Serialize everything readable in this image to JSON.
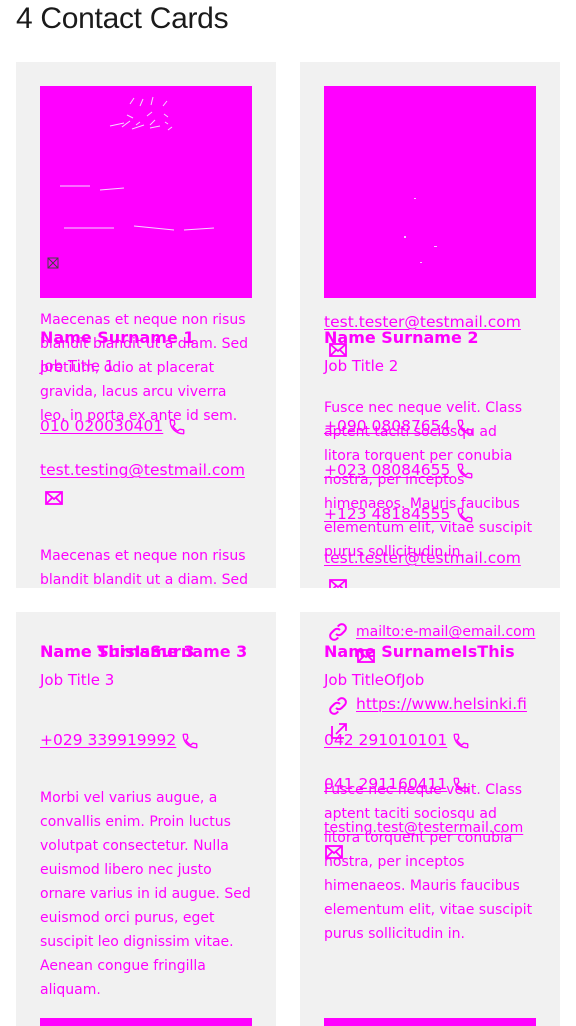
{
  "page": {
    "title": "4 Contact Cards"
  },
  "colors": {
    "accent": "#ff00ff",
    "card_bg": "#f1f1f1",
    "title_text": "#1a1a1a"
  },
  "cards": [
    {
      "name": "Name Surname 1",
      "job_title": "Job Title 1",
      "phones": [
        "010 020030401"
      ],
      "email": "test.testing@testmail.com",
      "about_top": "Maecenas et neque non risus blandit blandit ut a diam. Sed pretium, odio at placerat gravida, lacus arcu viverra leo, in porta ex ante id sem.",
      "about": "Maecenas et neque non risus blandit blandit ut a diam. Sed pretium, odio at placerat gravida, lacus arcu viverra leo, in porta ex ante id sem."
    },
    {
      "name": "Name Surname 2",
      "job_title": "Job Title 2",
      "email_top": "test.tester@testmail.com",
      "phones": [
        "+090 08087654",
        "+023 08084655",
        "+123 48184555"
      ],
      "email": "test.tester@testmail.com",
      "about": "Fusce nec neque velit. Class aptent taciti sociosqu ad litora torquent per conubia nostra, per inceptos himenaeos. Mauris faucibus elementum elit, vitae suscipit purus sollicitudin in."
    },
    {
      "name": "Name Surname 3",
      "name_overlap": "Name ThisIsSurname 3",
      "job_title": "Job Title 3",
      "phones": [
        "+029 339919992"
      ],
      "about": "Morbi vel varius augue, a convallis enim. Proin luctus volutpat consectetur. Nulla euismod libero nec justo ornare varius in id augue. Sed euismod orci purus, eget suscipit leo dignissim vitae. Aenean congue fringilla aliquam."
    },
    {
      "name": "Name SurnameIsThis",
      "job_title": "Job TitleOfJob",
      "links": [
        "mailto:e-mail@email.com",
        "https://www.helsinki.fi"
      ],
      "phones": [
        "042 291010101",
        "041 291160411"
      ],
      "email": "testing.test@testermail.com",
      "about": "Fusce nec neque velit. Class aptent taciti sociosqu ad litora torquent per conubia nostra, per inceptos himenaeos. Mauris faucibus elementum elit, vitae suscipit purus sollicitudin in."
    }
  ]
}
